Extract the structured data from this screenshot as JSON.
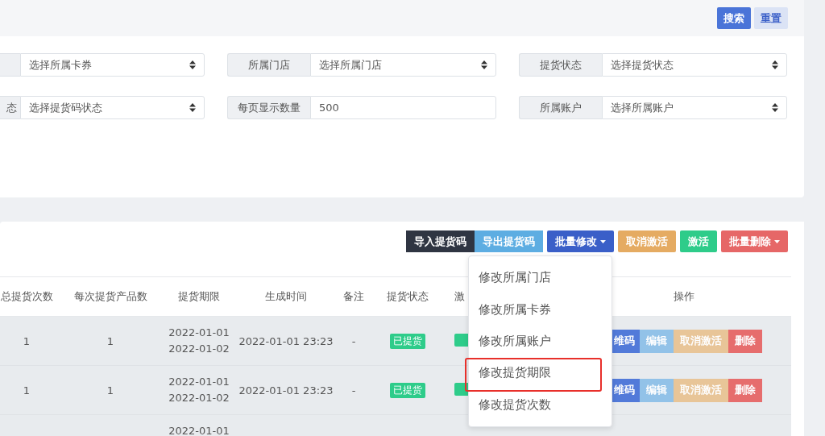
{
  "header": {
    "buttons": [
      {
        "label": "搜索",
        "kind": "primary"
      },
      {
        "label": "重置",
        "kind": "secondary"
      }
    ]
  },
  "filters": [
    {
      "kind": "select",
      "value": "选择所属卡券"
    },
    {
      "kind": "select",
      "label": "所属门店",
      "value": "选择所属门店"
    },
    {
      "kind": "select",
      "label": "提货状态",
      "value": "选择提货状态"
    },
    {
      "kind": "select",
      "label": "态",
      "value": "选择提货码状态"
    },
    {
      "kind": "input",
      "label": "每页显示数量",
      "value": "500"
    },
    {
      "kind": "select",
      "label": "所属账户",
      "value": "选择所属账户"
    }
  ],
  "toolbar": [
    {
      "label": "导入提货码",
      "color": "#2f3542",
      "caret": false
    },
    {
      "label": "导出提货码",
      "color": "#5dade2",
      "caret": false
    },
    {
      "label": "批量修改",
      "color": "#3a5fc8",
      "caret": true
    },
    {
      "label": "取消激活",
      "color": "#e5ab62",
      "caret": false
    },
    {
      "label": "激活",
      "color": "#2ecc8a",
      "caret": false
    },
    {
      "label": "批量删除",
      "color": "#e66767",
      "caret": true
    }
  ],
  "table": {
    "columns": [
      "总提货次数",
      "每次提货产品数",
      "提货期限",
      "生成时间",
      "备注",
      "提货状态",
      "激",
      "操作"
    ],
    "rows": [
      {
        "total_count": "1",
        "per_count": "1",
        "period": [
          "2022-01-01",
          "2022-01-02"
        ],
        "created": "2022-01-01 23:23",
        "note": "-",
        "pickup_status": "已提货",
        "activation": {
          "kind": "badge"
        },
        "actions": [
          {
            "label": "维码",
            "color": "#4a74d8"
          },
          {
            "label": "编辑",
            "color": "#8ec0e8"
          },
          {
            "label": "取消激活",
            "color": "#e8c394"
          },
          {
            "label": "删除",
            "color": "#e66767"
          }
        ]
      },
      {
        "total_count": "1",
        "per_count": "1",
        "period": [
          "2022-01-01",
          "2022-01-02"
        ],
        "created": "2022-01-01 23:23",
        "note": "-",
        "pickup_status": "已提货",
        "activation": {
          "kind": "badge"
        },
        "actions": [
          {
            "label": "维码",
            "color": "#4a74d8"
          },
          {
            "label": "编辑",
            "color": "#8ec0e8"
          },
          {
            "label": "取消激活",
            "color": "#e8c394"
          },
          {
            "label": "删除",
            "color": "#e66767"
          }
        ]
      },
      {
        "period": [
          "2022-01-01"
        ]
      }
    ]
  },
  "menu": {
    "items": [
      {
        "label": "修改所属门店",
        "highlighted": false
      },
      {
        "label": "修改所属卡券",
        "highlighted": false
      },
      {
        "label": "修改所属账户",
        "highlighted": false
      },
      {
        "label": "修改提货期限",
        "highlighted": true
      },
      {
        "label": "修改提货次数",
        "highlighted": false
      }
    ]
  }
}
